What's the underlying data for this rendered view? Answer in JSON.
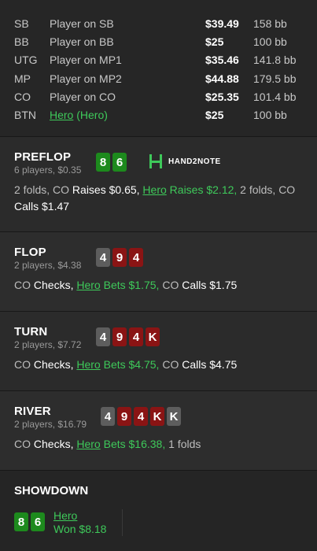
{
  "players": [
    {
      "pos": "SB",
      "name": "Player on SB",
      "stack": "$39.49",
      "bb": "158 bb",
      "hero": false
    },
    {
      "pos": "BB",
      "name": "Player on BB",
      "stack": "$25",
      "bb": "100 bb",
      "hero": false
    },
    {
      "pos": "UTG",
      "name": "Player on MP1",
      "stack": "$35.46",
      "bb": "141.8 bb",
      "hero": false
    },
    {
      "pos": "MP",
      "name": "Player on MP2",
      "stack": "$44.88",
      "bb": "179.5 bb",
      "hero": false
    },
    {
      "pos": "CO",
      "name": "Player on CO",
      "stack": "$25.35",
      "bb": "101.4 bb",
      "hero": false
    },
    {
      "pos": "BTN",
      "name": "Hero",
      "name_suffix": " (Hero)",
      "stack": "$25",
      "bb": "100 bb",
      "hero": true
    }
  ],
  "logo": {
    "text": "HAND2NOTE",
    "colors": {
      "accent": "#3ec95a"
    }
  },
  "streets": {
    "preflop": {
      "name": "PREFLOP",
      "sub": "6 players, $0.35",
      "cards": [
        {
          "rank": "8",
          "color": "green"
        },
        {
          "rank": "6",
          "color": "green"
        }
      ],
      "actions": [
        {
          "text": "2 folds, CO ",
          "style": "plain"
        },
        {
          "text": "Raises $0.65,",
          "style": "white"
        },
        {
          "text": " ",
          "style": "plain"
        },
        {
          "text": "Hero",
          "style": "hero"
        },
        {
          "text": " Raises $2.12,",
          "style": "green"
        },
        {
          "text": " 2 folds, CO ",
          "style": "plain"
        },
        {
          "text": "Calls $1.47",
          "style": "white"
        }
      ]
    },
    "flop": {
      "name": "FLOP",
      "sub": "2 players, $4.38",
      "cards": [
        {
          "rank": "4",
          "color": "gray"
        },
        {
          "rank": "9",
          "color": "red"
        },
        {
          "rank": "4",
          "color": "red"
        }
      ],
      "actions": [
        {
          "text": "CO ",
          "style": "plain"
        },
        {
          "text": "Checks,",
          "style": "white"
        },
        {
          "text": " ",
          "style": "plain"
        },
        {
          "text": "Hero",
          "style": "hero"
        },
        {
          "text": " Bets $1.75,",
          "style": "green"
        },
        {
          "text": " CO ",
          "style": "plain"
        },
        {
          "text": "Calls $1.75",
          "style": "white"
        }
      ]
    },
    "turn": {
      "name": "TURN",
      "sub": "2 players, $7.72",
      "cards": [
        {
          "rank": "4",
          "color": "gray"
        },
        {
          "rank": "9",
          "color": "red"
        },
        {
          "rank": "4",
          "color": "red"
        },
        {
          "rank": "K",
          "color": "red"
        }
      ],
      "actions": [
        {
          "text": "CO ",
          "style": "plain"
        },
        {
          "text": "Checks,",
          "style": "white"
        },
        {
          "text": " ",
          "style": "plain"
        },
        {
          "text": "Hero",
          "style": "hero"
        },
        {
          "text": " Bets $4.75,",
          "style": "green"
        },
        {
          "text": " CO ",
          "style": "plain"
        },
        {
          "text": "Calls $4.75",
          "style": "white"
        }
      ]
    },
    "river": {
      "name": "RIVER",
      "sub": "2 players, $16.79",
      "cards": [
        {
          "rank": "4",
          "color": "gray"
        },
        {
          "rank": "9",
          "color": "red"
        },
        {
          "rank": "4",
          "color": "red"
        },
        {
          "rank": "K",
          "color": "red"
        },
        {
          "rank": "K",
          "color": "gray"
        }
      ],
      "actions": [
        {
          "text": "CO ",
          "style": "plain"
        },
        {
          "text": "Checks,",
          "style": "white"
        },
        {
          "text": " ",
          "style": "plain"
        },
        {
          "text": "Hero",
          "style": "hero"
        },
        {
          "text": " Bets $16.38,",
          "style": "green"
        },
        {
          "text": " 1 folds",
          "style": "plain"
        }
      ]
    }
  },
  "showdown": {
    "title": "SHOWDOWN",
    "cards": [
      {
        "rank": "8",
        "color": "green"
      },
      {
        "rank": "6",
        "color": "green"
      }
    ],
    "player": "Hero",
    "result": "Won $8.18"
  }
}
